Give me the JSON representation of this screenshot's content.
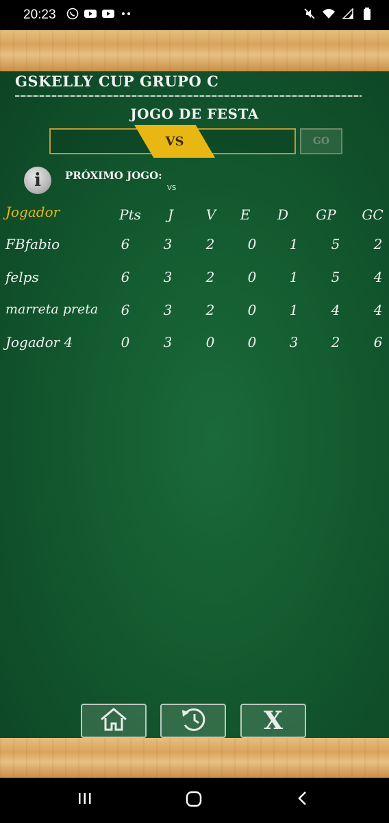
{
  "status_bar": {
    "time": "20:23",
    "left_icons": [
      "whatsapp-icon",
      "youtube-icon",
      "youtube-icon",
      "more-dots-icon"
    ],
    "right_icons": [
      "mute-icon",
      "wifi-icon",
      "signal-icon",
      "battery-icon"
    ]
  },
  "board": {
    "title": "GSKELLY CUP GRUPO C",
    "game_label": "JOGO DE FESTA",
    "vs_label": "VS",
    "go_label": "GO",
    "next_game_label": "PRÓXIMO JOGO:",
    "next_game_vs": "VS"
  },
  "table": {
    "headers": [
      "Jogador",
      "Pts",
      "J",
      "V",
      "E",
      "D",
      "GP",
      "GC"
    ],
    "rows": [
      [
        "FBfabio",
        "6",
        "3",
        "2",
        "0",
        "1",
        "5",
        "2"
      ],
      [
        "felps",
        "6",
        "3",
        "2",
        "0",
        "1",
        "5",
        "4"
      ],
      [
        "marreta preta",
        "6",
        "3",
        "2",
        "0",
        "1",
        "4",
        "4"
      ],
      [
        "Jogador 4",
        "0",
        "3",
        "0",
        "0",
        "3",
        "2",
        "6"
      ]
    ]
  },
  "bottom_buttons": [
    "home-icon",
    "history-icon",
    "close-icon"
  ],
  "bottom_button_x_label": "X",
  "colors": {
    "board": "#135a30",
    "accent_yellow": "#e8b714",
    "chalk": "#f2f2f2",
    "wood": "#d9a45d"
  }
}
